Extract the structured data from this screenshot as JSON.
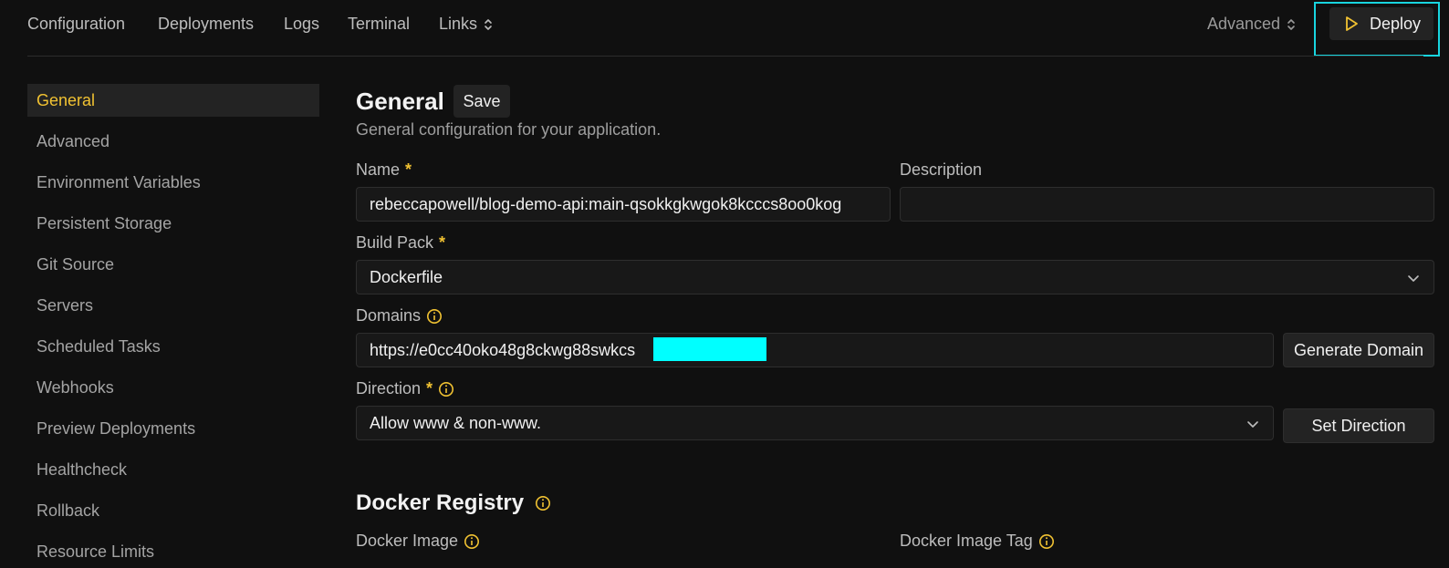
{
  "topnav": {
    "items": [
      "Configuration",
      "Deployments",
      "Logs",
      "Terminal",
      "Links"
    ],
    "advanced": "Advanced",
    "deploy": "Deploy"
  },
  "sidebar": {
    "items": [
      "General",
      "Advanced",
      "Environment Variables",
      "Persistent Storage",
      "Git Source",
      "Servers",
      "Scheduled Tasks",
      "Webhooks",
      "Preview Deployments",
      "Healthcheck",
      "Rollback",
      "Resource Limits"
    ],
    "active": "General"
  },
  "general": {
    "title": "General",
    "save": "Save",
    "subtitle": "General configuration for your application.",
    "name_label": "Name",
    "name_value": "rebeccapowell/blog-demo-api:main-qsokkgkwgok8kcccs8oo0kog",
    "required_mark": "*",
    "description_label": "Description",
    "description_value": "",
    "buildpack_label": "Build Pack",
    "buildpack_value": "Dockerfile",
    "domains_label": "Domains",
    "domains_value": "https://e0cc40oko48g8ckwg88swkcs",
    "generate_domain": "Generate Domain",
    "direction_label": "Direction",
    "direction_value": "Allow www & non-www.",
    "set_direction": "Set Direction"
  },
  "docker": {
    "title": "Docker Registry",
    "image_label": "Docker Image",
    "tag_label": "Docker Image Tag"
  },
  "colors": {
    "accent": "#f1c232",
    "highlight": "#18d5df",
    "redaction": "#00ffff",
    "background": "#101010"
  }
}
